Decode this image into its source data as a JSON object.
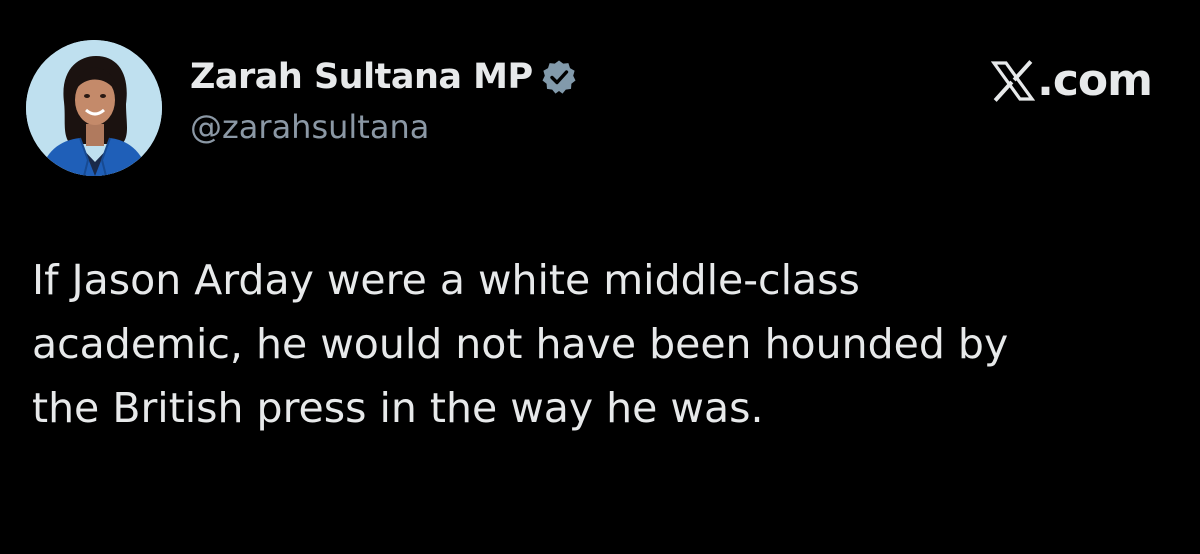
{
  "author": {
    "display_name": "Zarah Sultana MP",
    "handle": "@zarahsultana",
    "verified": true
  },
  "brand": {
    "text": ".com",
    "icon": "x-logo-icon"
  },
  "tweet": {
    "lines": [
      "If Jason Arday were a white middle-class",
      "academic, he would not have been hounded by",
      "the British press in the way he was."
    ]
  },
  "colors": {
    "background": "#000000",
    "primary_text": "#e7e9ea",
    "secondary_text": "#8b98a5",
    "badge": "#829aab",
    "avatar_bg": "#bfe0ef",
    "jacket": "#1f5fb8"
  }
}
